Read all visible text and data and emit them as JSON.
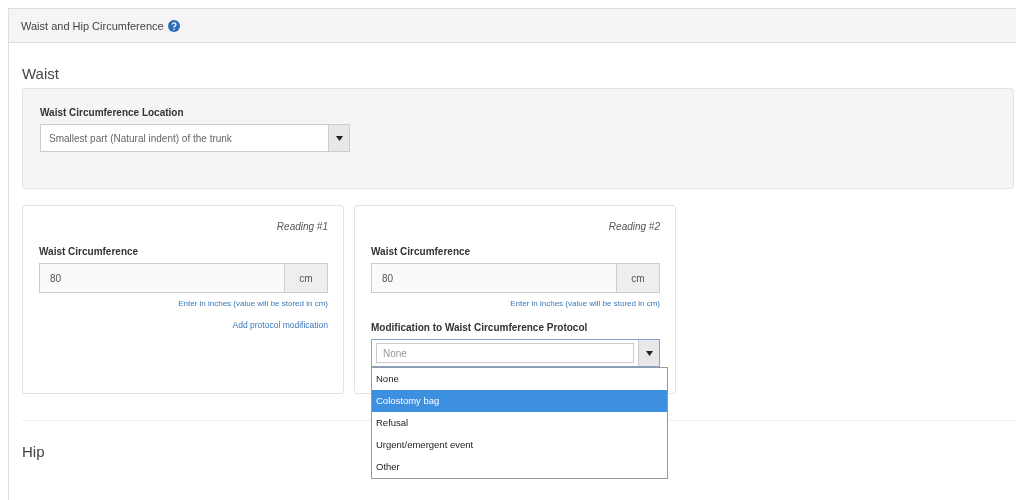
{
  "panel": {
    "title": "Waist and Hip Circumference"
  },
  "waist": {
    "heading": "Waist",
    "location": {
      "label": "Waist Circumference Location",
      "value": "Smallest part (Natural indent) of the trunk"
    },
    "readings": [
      {
        "title": "Reading #1",
        "label": "Waist Circumference",
        "value": "80",
        "unit": "cm",
        "help": "Enter in inches (value will be stored in cm)",
        "link": "Add protocol modification"
      },
      {
        "title": "Reading #2",
        "label": "Waist Circumference",
        "value": "80",
        "unit": "cm",
        "help": "Enter in inches (value will be stored in cm)",
        "modification": {
          "label": "Modification to Waist Circumference Protocol",
          "placeholder": "None",
          "expanded": true,
          "options": [
            {
              "label": "None",
              "selected": false
            },
            {
              "label": "Colostomy bag",
              "selected": true
            },
            {
              "label": "Refusal",
              "selected": false
            },
            {
              "label": "Urgent/emergent event",
              "selected": false
            },
            {
              "label": "Other",
              "selected": false
            }
          ]
        }
      }
    ]
  },
  "hip": {
    "heading": "Hip"
  }
}
